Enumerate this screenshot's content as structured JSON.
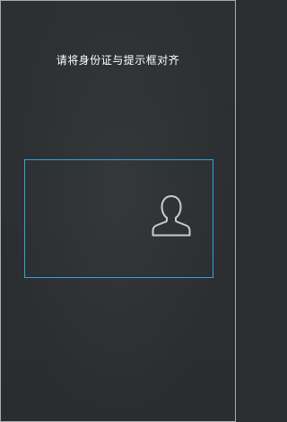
{
  "scan": {
    "hint_text": "请将身份证与提示框对齐"
  },
  "icons": {
    "portrait": "person-outline-icon"
  },
  "colors": {
    "background": "#2b2e31",
    "frame_border": "#2ea6d8",
    "icon_stroke": "#c9cbcd",
    "hint_text": "#ffffff"
  }
}
